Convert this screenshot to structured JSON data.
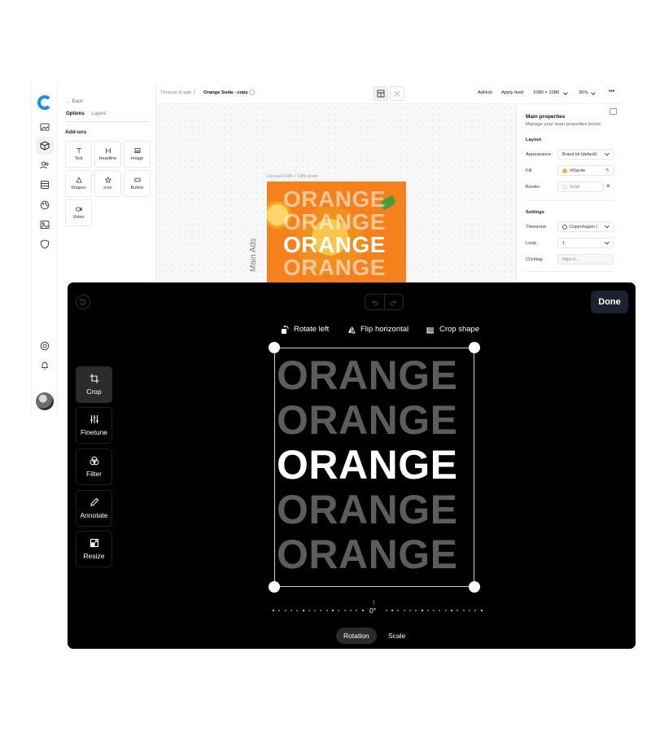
{
  "editor": {
    "rail": {
      "icons": [
        "logo-icon",
        "image-icon",
        "cube-icon",
        "users-icon",
        "database-icon",
        "palette-icon",
        "photo-icon",
        "shield-icon",
        "help-icon",
        "bell-icon"
      ]
    },
    "left_panel": {
      "back_label": "Back",
      "tabs": [
        {
          "label": "Options",
          "active": true
        },
        {
          "label": "Layers",
          "active": false
        }
      ],
      "section_title": "Add-ons",
      "addons": [
        {
          "label": "Text",
          "icon": "text-icon"
        },
        {
          "label": "Headline",
          "icon": "headline-icon"
        },
        {
          "label": "Image",
          "icon": "image-icon"
        },
        {
          "label": "Shapes",
          "icon": "shapes-icon"
        },
        {
          "label": "Icon",
          "icon": "star-icon"
        },
        {
          "label": "Button",
          "icon": "button-icon"
        },
        {
          "label": "Video",
          "icon": "video-icon"
        }
      ]
    },
    "topbar": {
      "breadcrumb_owner": "Thomas Kragh",
      "breadcrumb_sep": "/",
      "breadcrumb_file": "Orange Soda - copy",
      "adhub": "AdHub",
      "apply_feed": "Apply feed",
      "size": "1080 × 1080",
      "zoom": "36%",
      "more": "•••"
    },
    "canvas": {
      "size_label": "Carousel 1080 × 1080 pixels",
      "vertical_label": "Main Ads",
      "ad_words": [
        "ORANGE",
        "ORANGE",
        "ORANGE",
        "ORANGE"
      ]
    },
    "right_panel": {
      "title": "Main properties",
      "subtitle": "Manage your main properties below",
      "layout_title": "Layout",
      "appearance_label": "Appearance",
      "appearance_value": "Brand kit (default)",
      "fill_label": "Fill",
      "fill_value": "#f3ac4e",
      "fill_color": "#f3ac4e",
      "border_label": "Border",
      "border_value": "Solid",
      "settings_title": "Settings",
      "timezone_label": "Timezone",
      "timezone_value": "Copenhagen (",
      "loop_label": "Loop",
      "loop_value": "1",
      "clicktag_label": "Clicktag",
      "clicktag_placeholder": "https://..."
    }
  },
  "crop_modal": {
    "done_label": "Done",
    "toolbar": [
      {
        "label": "Rotate left",
        "icon": "rotate-left-icon"
      },
      {
        "label": "Flip horizontal",
        "icon": "flip-horizontal-icon"
      },
      {
        "label": "Crop shape",
        "icon": "crop-shape-icon"
      }
    ],
    "tools": [
      {
        "label": "Crop",
        "icon": "crop-icon",
        "active": true
      },
      {
        "label": "Finetune",
        "icon": "finetune-icon",
        "active": false
      },
      {
        "label": "Filter",
        "icon": "filter-icon",
        "active": false
      },
      {
        "label": "Annotate",
        "icon": "annotate-icon",
        "active": false
      },
      {
        "label": "Resize",
        "icon": "resize-icon",
        "active": false
      }
    ],
    "image_words": [
      "ORANGE",
      "ORANGE",
      "ORANGE",
      "ORANGE",
      "ORANGE"
    ],
    "highlight_word_index": 2,
    "rotation_value": "0°",
    "modes": [
      {
        "label": "Rotation",
        "active": true
      },
      {
        "label": "Scale",
        "active": false
      }
    ]
  },
  "colors": {
    "accent": "#1a8fe8",
    "ad_background": "#f4811b",
    "done_button": "#1c2230"
  }
}
